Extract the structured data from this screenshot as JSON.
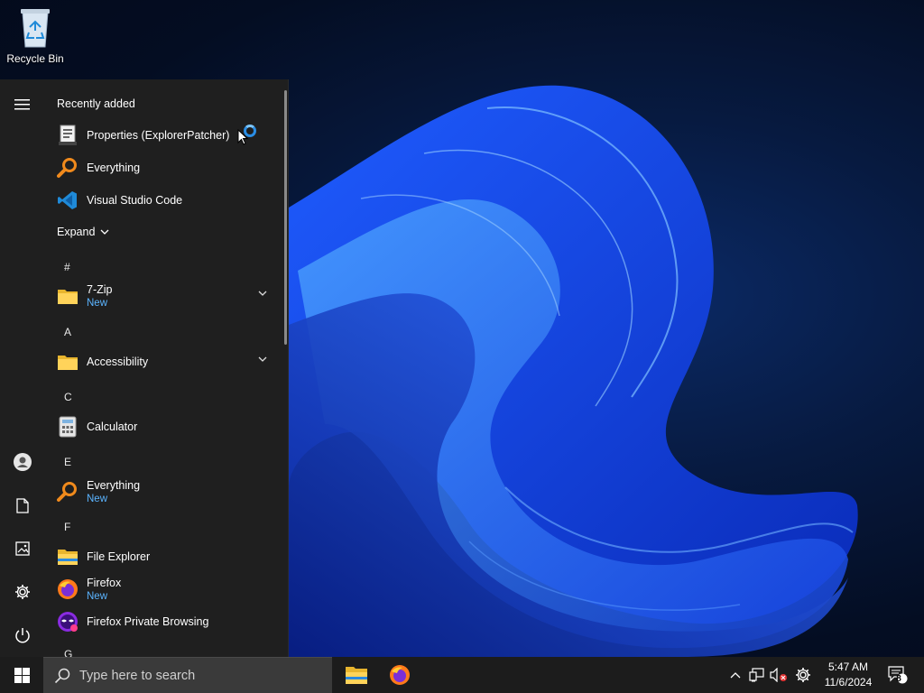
{
  "desktop": {
    "recycle_bin_label": "Recycle Bin"
  },
  "start_menu": {
    "recently_added_label": "Recently added",
    "recent_items": [
      {
        "name": "Properties (ExplorerPatcher)",
        "icon": "properties-icon"
      },
      {
        "name": "Everything",
        "icon": "everything-search-icon"
      },
      {
        "name": "Visual Studio Code",
        "icon": "vscode-icon"
      }
    ],
    "expand_label": "Expand",
    "groups": [
      {
        "letter": "#",
        "apps": [
          {
            "name": "7-Zip",
            "badge": "New",
            "icon": "folder-icon",
            "expandable": true
          }
        ]
      },
      {
        "letter": "A",
        "apps": [
          {
            "name": "Accessibility",
            "badge": "",
            "icon": "folder-icon",
            "expandable": true
          }
        ]
      },
      {
        "letter": "C",
        "apps": [
          {
            "name": "Calculator",
            "badge": "",
            "icon": "calculator-icon",
            "expandable": false
          }
        ]
      },
      {
        "letter": "E",
        "apps": [
          {
            "name": "Everything",
            "badge": "New",
            "icon": "everything-search-icon",
            "expandable": false
          }
        ]
      },
      {
        "letter": "F",
        "apps": [
          {
            "name": "File Explorer",
            "badge": "",
            "icon": "file-explorer-icon",
            "expandable": false
          },
          {
            "name": "Firefox",
            "badge": "New",
            "icon": "firefox-icon",
            "expandable": false
          },
          {
            "name": "Firefox Private Browsing",
            "badge": "",
            "icon": "firefox-private-icon",
            "expandable": false
          }
        ]
      },
      {
        "letter": "G",
        "apps": []
      }
    ]
  },
  "taskbar": {
    "search_placeholder": "Type here to search",
    "time": "5:47 AM",
    "date": "11/6/2024",
    "notification_count": "8"
  },
  "colors": {
    "menu_bg": "#1f1f1f",
    "taskbar_bg": "#1c1c1c",
    "new_badge": "#5bb4ff",
    "accent": "#0078d4"
  }
}
